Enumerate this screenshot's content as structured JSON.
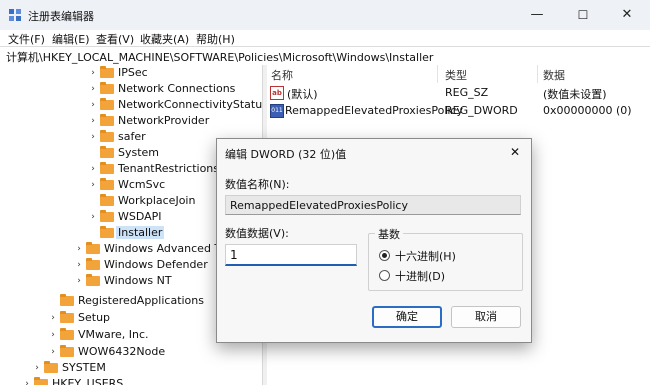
{
  "window": {
    "title": "注册表编辑器",
    "controls": {
      "minimize": "—",
      "maximize": "☐",
      "close": "✕"
    }
  },
  "menu": [
    "文件(F)",
    "编辑(E)",
    "查看(V)",
    "收藏夹(A)",
    "帮助(H)"
  ],
  "address": "计算机\\HKEY_LOCAL_MACHINE\\SOFTWARE\\Policies\\Microsoft\\Windows\\Installer",
  "tree": [
    {
      "label": "IPSec",
      "chevron": "›"
    },
    {
      "label": "Network Connections",
      "chevron": "›"
    },
    {
      "label": "NetworkConnectivityStatusI",
      "chevron": "›"
    },
    {
      "label": "NetworkProvider",
      "chevron": "›"
    },
    {
      "label": "safer",
      "chevron": "›"
    },
    {
      "label": "System",
      "chevron": ""
    },
    {
      "label": "TenantRestrictions",
      "chevron": "›"
    },
    {
      "label": "WcmSvc",
      "chevron": "›"
    },
    {
      "label": "WorkplaceJoin",
      "chevron": ""
    },
    {
      "label": "WSDAPI",
      "chevron": "›"
    },
    {
      "label": "Installer",
      "chevron": ""
    },
    {
      "label": "Windows Advanced Thr",
      "chevron": "›"
    },
    {
      "label": "Windows Defender",
      "chevron": "›"
    },
    {
      "label": "Windows NT",
      "chevron": "›"
    },
    {
      "label": "RegisteredApplications",
      "chevron": ""
    },
    {
      "label": "Setup",
      "chevron": "›"
    },
    {
      "label": "VMware, Inc.",
      "chevron": "›"
    },
    {
      "label": "WOW6432Node",
      "chevron": "›"
    },
    {
      "label": "SYSTEM",
      "chevron": "›"
    },
    {
      "label": "HKEY_USERS",
      "chevron": "›"
    }
  ],
  "list": {
    "columns": [
      "名称",
      "类型",
      "数据"
    ],
    "rows": [
      {
        "icon": "ab",
        "name": "(默认)",
        "type": "REG_SZ",
        "data": "(数值未设置)"
      },
      {
        "icon": "011",
        "name": "RemappedElevatedProxiesPolicy",
        "type": "REG_DWORD",
        "data": "0x00000000 (0)"
      }
    ]
  },
  "dialog": {
    "title": "编辑 DWORD (32 位)值",
    "close": "✕",
    "name_label": "数值名称(N):",
    "name_value": "RemappedElevatedProxiesPolicy",
    "data_label": "数值数据(V):",
    "data_value": "1",
    "base_title": "基数",
    "base_hex": "十六进制(H)",
    "base_dec": "十进制(D)",
    "ok": "确定",
    "cancel": "取消"
  },
  "colors": {
    "folder": "#f2a33a",
    "accent": "#2b6cc4",
    "selection": "#cde3f7"
  }
}
